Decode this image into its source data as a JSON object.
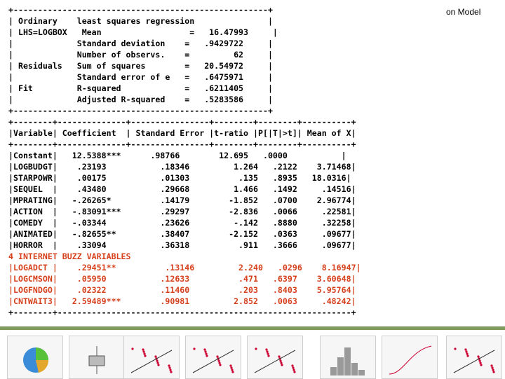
{
  "header": {
    "corner_title": "on Model"
  },
  "regression_output": {
    "lines": [
      {
        "text": "+----------------------------------------------------+",
        "highlight": false
      },
      {
        "text": "| Ordinary    least squares regression               |",
        "highlight": false
      },
      {
        "text": "| LHS=LOGBOX   Mean                  =   16.47993     |",
        "highlight": false
      },
      {
        "text": "|             Standard deviation    =   .9429722     |",
        "highlight": false
      },
      {
        "text": "|             Number of observs.    =         62     |",
        "highlight": false
      },
      {
        "text": "| Residuals   Sum of squares        =   20.54972     |",
        "highlight": false
      },
      {
        "text": "|             Standard error of e   =   .6475971     |",
        "highlight": false
      },
      {
        "text": "| Fit         R-squared             =   .6211405     |",
        "highlight": false
      },
      {
        "text": "|             Adjusted R-squared    =   .5283586     |",
        "highlight": false
      },
      {
        "text": "+----------------------------------------------------+",
        "highlight": false
      },
      {
        "text": "+--------+--------------+----------------+--------+--------+----------+",
        "highlight": false
      },
      {
        "text": "|Variable| Coefficient  | Standard Error |t-ratio |P[|T|>t]| Mean of X|",
        "highlight": false
      },
      {
        "text": "+--------+--------------+----------------+--------+--------+----------+",
        "highlight": false
      },
      {
        "text": "|Constant|   12.5388***      .98766        12.695   .0000           |",
        "highlight": false
      },
      {
        "text": "|LOGBUDGT|    .23193           .18346         1.264   .2122    3.71468|",
        "highlight": false
      },
      {
        "text": "|STARPOWR|    .00175           .01303          .135   .8935   18.0316|",
        "highlight": false
      },
      {
        "text": "|SEQUEL  |    .43480           .29668         1.466   .1492     .14516|",
        "highlight": false
      },
      {
        "text": "|MPRATING|   -.26265*          .14179        -1.852   .0700    2.96774|",
        "highlight": false
      },
      {
        "text": "|ACTION  |   -.83091***        .29297        -2.836   .0066     .22581|",
        "highlight": false
      },
      {
        "text": "|COMEDY  |   -.03344           .23626         -.142   .8880     .32258|",
        "highlight": false
      },
      {
        "text": "|ANIMATED|   -.82655**         .38407        -2.152   .0363     .09677|",
        "highlight": false
      },
      {
        "text": "|HORROR  |    .33094           .36318          .911   .3666     .09677|",
        "highlight": false
      },
      {
        "text": "4 INTERNET BUZZ VARIABLES",
        "highlight": true
      },
      {
        "text": "|LOGADCT |    .29451**          .13146         2.240   .0296    8.16947|",
        "highlight": true
      },
      {
        "text": "|LOGCMSON|    .05950           .12633          .471   .6397    3.60648|",
        "highlight": true
      },
      {
        "text": "|LOGFNDGO|    .02322           .11460          .203   .8403    5.95764|",
        "highlight": true
      },
      {
        "text": "|CNTWAIT3|   2.59489***        .90981         2.852   .0063     .48242|",
        "highlight": true
      },
      {
        "text": "+--------+------------------------------------------------------------+",
        "highlight": false
      }
    ]
  },
  "thumbnails": [
    {
      "kind": "pie-chart-icon"
    },
    {
      "kind": "box-plot-icon"
    },
    {
      "kind": "scatter-plot-icon"
    },
    {
      "kind": "probability-plot-icon"
    },
    {
      "kind": "scatter-plot-icon"
    },
    {
      "kind": "histogram-icon"
    },
    {
      "kind": "cumulative-curve-icon"
    },
    {
      "kind": "scatter-histogram-icon"
    }
  ],
  "colors": {
    "highlight": "#d6401c",
    "strip_bar": "#7f9b5d"
  }
}
